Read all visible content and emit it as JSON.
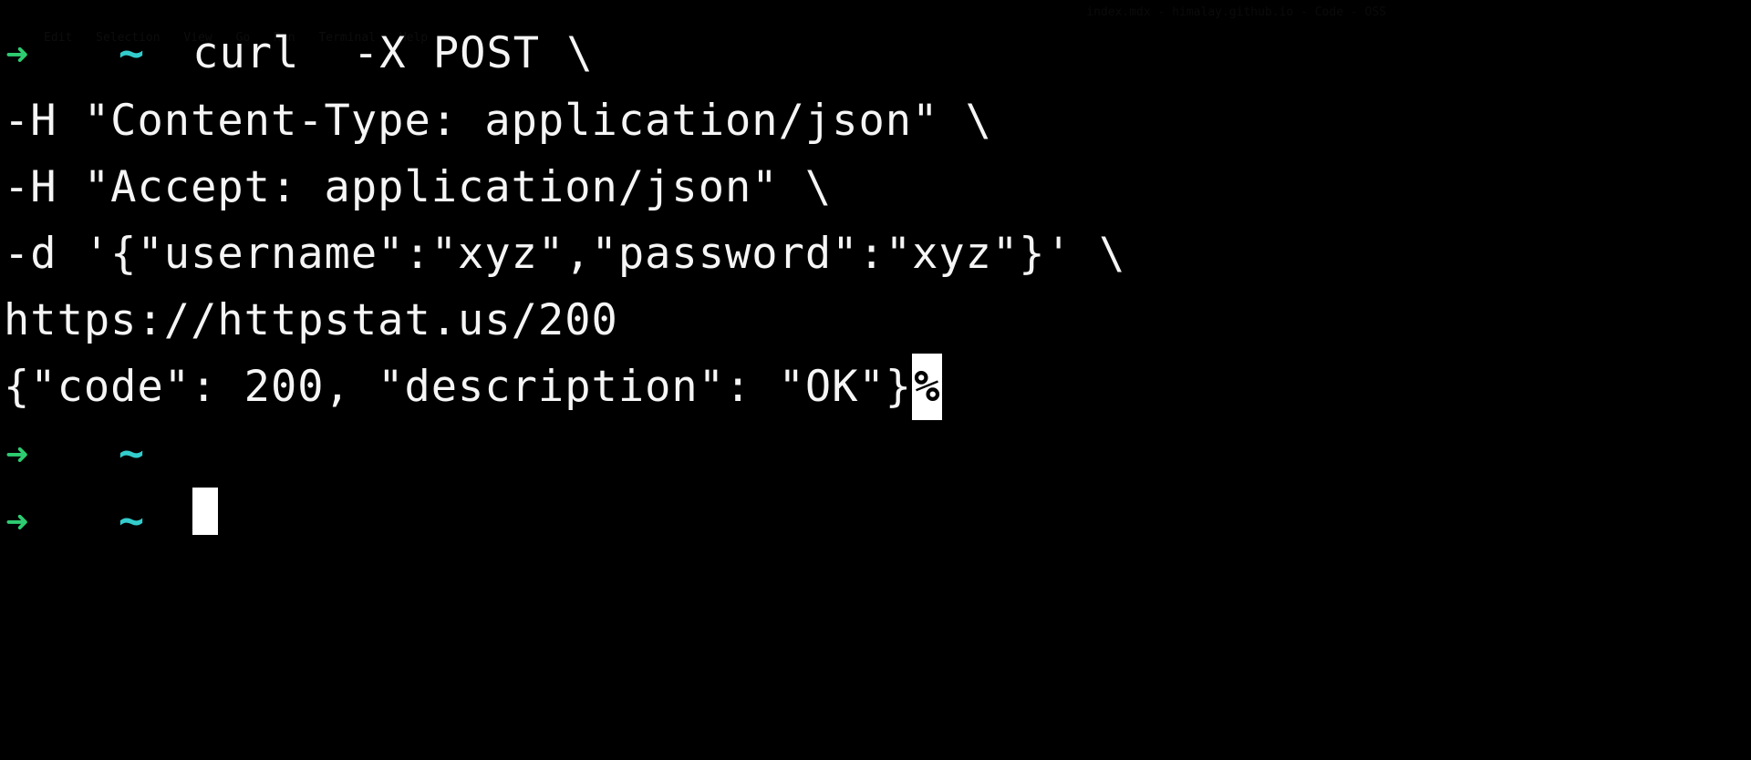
{
  "window": {
    "title": "index.mdx - himalay.github.io - Code - OSS"
  },
  "menubar": {
    "items": [
      "Edit",
      "Selection",
      "View",
      "Go",
      "Run",
      "Terminal",
      "Help"
    ]
  },
  "terminal": {
    "prompt_arrow": "➜",
    "prompt_tilde": "~",
    "cmd_line1": " curl  -X POST \\",
    "cmd_line2": "-H \"Content-Type: application/json\" \\",
    "cmd_line3": "-H \"Accept: application/json\" \\",
    "cmd_line4": "-d '{\"username\":\"xyz\",\"password\":\"xyz\"}' \\",
    "cmd_line5": "https://httpstat.us/200",
    "response": "{\"code\": 200, \"description\": \"OK\"}",
    "percent": "%"
  }
}
